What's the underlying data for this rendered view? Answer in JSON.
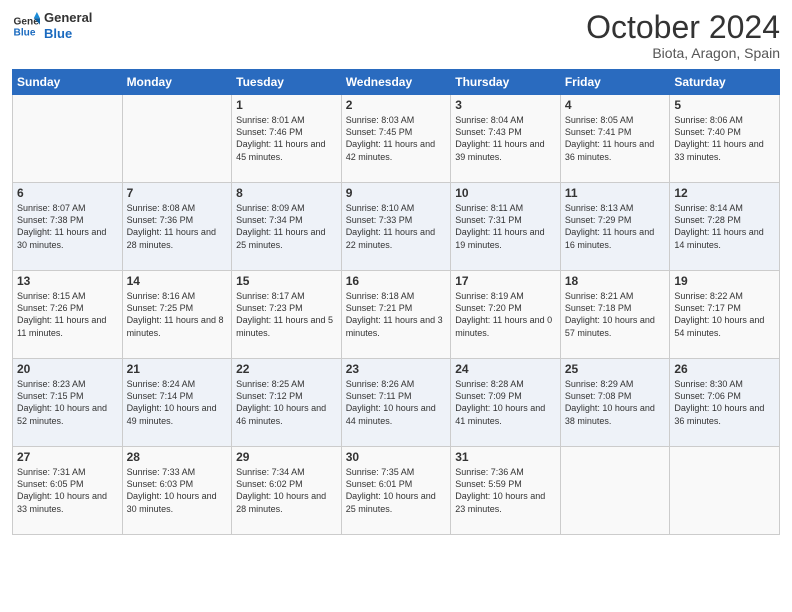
{
  "header": {
    "logo_general": "General",
    "logo_blue": "Blue",
    "month": "October 2024",
    "location": "Biota, Aragon, Spain"
  },
  "days_of_week": [
    "Sunday",
    "Monday",
    "Tuesday",
    "Wednesday",
    "Thursday",
    "Friday",
    "Saturday"
  ],
  "weeks": [
    [
      {
        "day": "",
        "content": ""
      },
      {
        "day": "",
        "content": ""
      },
      {
        "day": "1",
        "content": "Sunrise: 8:01 AM\nSunset: 7:46 PM\nDaylight: 11 hours and 45 minutes."
      },
      {
        "day": "2",
        "content": "Sunrise: 8:03 AM\nSunset: 7:45 PM\nDaylight: 11 hours and 42 minutes."
      },
      {
        "day": "3",
        "content": "Sunrise: 8:04 AM\nSunset: 7:43 PM\nDaylight: 11 hours and 39 minutes."
      },
      {
        "day": "4",
        "content": "Sunrise: 8:05 AM\nSunset: 7:41 PM\nDaylight: 11 hours and 36 minutes."
      },
      {
        "day": "5",
        "content": "Sunrise: 8:06 AM\nSunset: 7:40 PM\nDaylight: 11 hours and 33 minutes."
      }
    ],
    [
      {
        "day": "6",
        "content": "Sunrise: 8:07 AM\nSunset: 7:38 PM\nDaylight: 11 hours and 30 minutes."
      },
      {
        "day": "7",
        "content": "Sunrise: 8:08 AM\nSunset: 7:36 PM\nDaylight: 11 hours and 28 minutes."
      },
      {
        "day": "8",
        "content": "Sunrise: 8:09 AM\nSunset: 7:34 PM\nDaylight: 11 hours and 25 minutes."
      },
      {
        "day": "9",
        "content": "Sunrise: 8:10 AM\nSunset: 7:33 PM\nDaylight: 11 hours and 22 minutes."
      },
      {
        "day": "10",
        "content": "Sunrise: 8:11 AM\nSunset: 7:31 PM\nDaylight: 11 hours and 19 minutes."
      },
      {
        "day": "11",
        "content": "Sunrise: 8:13 AM\nSunset: 7:29 PM\nDaylight: 11 hours and 16 minutes."
      },
      {
        "day": "12",
        "content": "Sunrise: 8:14 AM\nSunset: 7:28 PM\nDaylight: 11 hours and 14 minutes."
      }
    ],
    [
      {
        "day": "13",
        "content": "Sunrise: 8:15 AM\nSunset: 7:26 PM\nDaylight: 11 hours and 11 minutes."
      },
      {
        "day": "14",
        "content": "Sunrise: 8:16 AM\nSunset: 7:25 PM\nDaylight: 11 hours and 8 minutes."
      },
      {
        "day": "15",
        "content": "Sunrise: 8:17 AM\nSunset: 7:23 PM\nDaylight: 11 hours and 5 minutes."
      },
      {
        "day": "16",
        "content": "Sunrise: 8:18 AM\nSunset: 7:21 PM\nDaylight: 11 hours and 3 minutes."
      },
      {
        "day": "17",
        "content": "Sunrise: 8:19 AM\nSunset: 7:20 PM\nDaylight: 11 hours and 0 minutes."
      },
      {
        "day": "18",
        "content": "Sunrise: 8:21 AM\nSunset: 7:18 PM\nDaylight: 10 hours and 57 minutes."
      },
      {
        "day": "19",
        "content": "Sunrise: 8:22 AM\nSunset: 7:17 PM\nDaylight: 10 hours and 54 minutes."
      }
    ],
    [
      {
        "day": "20",
        "content": "Sunrise: 8:23 AM\nSunset: 7:15 PM\nDaylight: 10 hours and 52 minutes."
      },
      {
        "day": "21",
        "content": "Sunrise: 8:24 AM\nSunset: 7:14 PM\nDaylight: 10 hours and 49 minutes."
      },
      {
        "day": "22",
        "content": "Sunrise: 8:25 AM\nSunset: 7:12 PM\nDaylight: 10 hours and 46 minutes."
      },
      {
        "day": "23",
        "content": "Sunrise: 8:26 AM\nSunset: 7:11 PM\nDaylight: 10 hours and 44 minutes."
      },
      {
        "day": "24",
        "content": "Sunrise: 8:28 AM\nSunset: 7:09 PM\nDaylight: 10 hours and 41 minutes."
      },
      {
        "day": "25",
        "content": "Sunrise: 8:29 AM\nSunset: 7:08 PM\nDaylight: 10 hours and 38 minutes."
      },
      {
        "day": "26",
        "content": "Sunrise: 8:30 AM\nSunset: 7:06 PM\nDaylight: 10 hours and 36 minutes."
      }
    ],
    [
      {
        "day": "27",
        "content": "Sunrise: 7:31 AM\nSunset: 6:05 PM\nDaylight: 10 hours and 33 minutes."
      },
      {
        "day": "28",
        "content": "Sunrise: 7:33 AM\nSunset: 6:03 PM\nDaylight: 10 hours and 30 minutes."
      },
      {
        "day": "29",
        "content": "Sunrise: 7:34 AM\nSunset: 6:02 PM\nDaylight: 10 hours and 28 minutes."
      },
      {
        "day": "30",
        "content": "Sunrise: 7:35 AM\nSunset: 6:01 PM\nDaylight: 10 hours and 25 minutes."
      },
      {
        "day": "31",
        "content": "Sunrise: 7:36 AM\nSunset: 5:59 PM\nDaylight: 10 hours and 23 minutes."
      },
      {
        "day": "",
        "content": ""
      },
      {
        "day": "",
        "content": ""
      }
    ]
  ]
}
